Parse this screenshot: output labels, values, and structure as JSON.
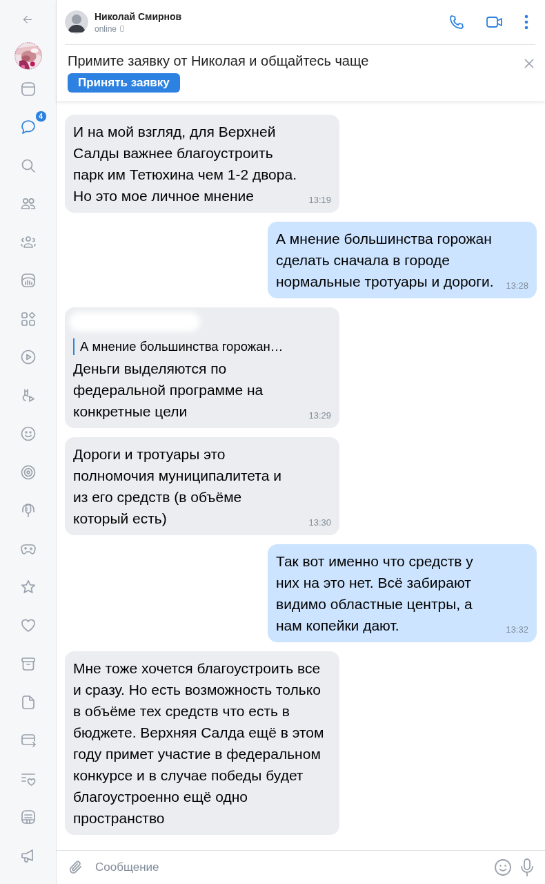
{
  "sidebar": {
    "items": [
      {
        "selected": false
      },
      {
        "selected": true,
        "badge": "4"
      },
      {
        "selected": false
      },
      {
        "selected": false
      },
      {
        "selected": false
      },
      {
        "selected": false
      },
      {
        "selected": false
      },
      {
        "selected": false
      },
      {
        "selected": false
      },
      {
        "selected": false
      },
      {
        "selected": false
      },
      {
        "selected": false
      },
      {
        "selected": false
      },
      {
        "selected": false
      },
      {
        "selected": false
      },
      {
        "selected": false
      },
      {
        "selected": false
      },
      {
        "selected": false
      },
      {
        "selected": false
      },
      {
        "selected": false
      },
      {
        "selected": false
      }
    ]
  },
  "contact": {
    "name": "Николай Смирнов",
    "status": "online"
  },
  "request_banner": {
    "text": "Примите заявку от Николая и общайтесь чаще",
    "button": "Принять заявку"
  },
  "messages": [
    {
      "outgoing": false,
      "text": "И на мой взгляд, для Верхней Салды важнее благоустроить парк им Тетюхина чем 1-2 двора. Но это мое личное мнение",
      "time": "13:19"
    },
    {
      "outgoing": true,
      "text": "А мнение большинства горожан сделать сначала в городе нормальные тротуары и дороги.",
      "time": "13:28"
    },
    {
      "outgoing": false,
      "redacted_sender": true,
      "quote": "А мнение большинства горожан…",
      "text": "Деньги выделяются по федеральной программе на конкретные цели",
      "time": "13:29"
    },
    {
      "outgoing": false,
      "text": "Дороги и тротуары это полномочия муниципалитета и из его средств (в объёме который есть)",
      "time": "13:30"
    },
    {
      "outgoing": true,
      "text": "Так вот именно что средств у них на это нет. Всё забирают видимо областные центры, а нам копейки дают.",
      "time": "13:32"
    },
    {
      "outgoing": false,
      "text": "Мне тоже хочется благоустроить все и сразу. Но есть возможность только в объёме тех средств что есть в бюджете. Верхняя Салда ещё в этом году примет участие в федеральном конкурсе и в случае победы будет благоустроенно ещё одно пространство"
    }
  ],
  "composer": {
    "placeholder": "Сообщение"
  }
}
